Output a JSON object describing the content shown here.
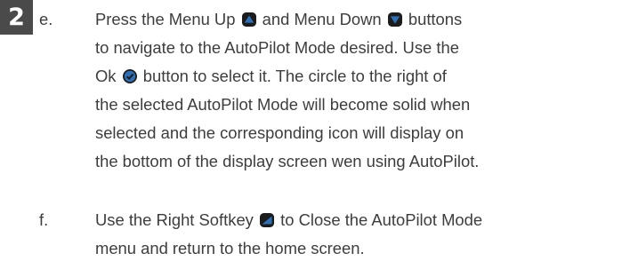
{
  "step_number": "2",
  "items": {
    "e": {
      "marker": "e.",
      "line1_a": "Press the Menu Up",
      "line1_b": "and Menu Down",
      "line1_c": "buttons",
      "line2": "to navigate to the AutoPilot Mode desired. Use the",
      "line3_a": "Ok",
      "line3_b": "button to select it. The circle to the right of",
      "line4": "the selected AutoPilot Mode will become solid when",
      "line5": "selected and the corresponding icon will display on",
      "line6": "the bottom of the display screen wen using AutoPilot."
    },
    "f": {
      "marker": "f.",
      "line1_a": "Use the Right Softkey",
      "line1_b": "to Close the AutoPilot Mode",
      "line2": "menu and return to the home screen."
    }
  },
  "icons": {
    "menu_up": "menu-up-icon",
    "menu_down": "menu-down-icon",
    "ok": "ok-icon",
    "right_softkey": "right-softkey-icon",
    "color_dark": "#1c1c1c",
    "color_blue": "#2f6fb6"
  }
}
